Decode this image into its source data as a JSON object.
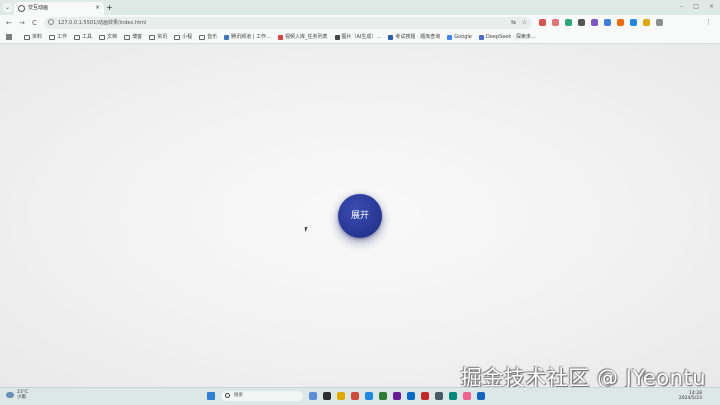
{
  "tab": {
    "title": "交互动画",
    "close": "×",
    "new_tab": "+"
  },
  "window_controls": [
    "–",
    "□",
    "×"
  ],
  "nav": {
    "back": "←",
    "forward": "→",
    "reload": "C"
  },
  "omnibox": {
    "url": "127.0.0.1:5501/动画效果/index.html"
  },
  "bookmarks": [
    {
      "label": "资料",
      "type": "folder"
    },
    {
      "label": "工作",
      "type": "folder"
    },
    {
      "label": "工具",
      "type": "folder"
    },
    {
      "label": "文档",
      "type": "folder"
    },
    {
      "label": "博客",
      "type": "folder"
    },
    {
      "label": "资讯",
      "type": "folder"
    },
    {
      "label": "小程",
      "type": "folder"
    },
    {
      "label": "音乐",
      "type": "folder"
    },
    {
      "label": "腾讯频道 | 工作…",
      "type": "link",
      "color": "#3a77c4"
    },
    {
      "label": "视频入库_任务列表",
      "type": "link",
      "color": "#d44"
    },
    {
      "label": "图片（AI生成）…",
      "type": "link",
      "color": "#444"
    },
    {
      "label": "考试搜题 · 题库查询",
      "type": "link",
      "color": "#2a5fb3"
    },
    {
      "label": "Google",
      "type": "link",
      "color": "#4285f4"
    },
    {
      "label": "DeepSeek · 探索未…",
      "type": "link",
      "color": "#4b6bd6"
    }
  ],
  "extensions": [
    "#d9534f",
    "#e57373",
    "#2aa876",
    "#555555",
    "#7e57c2",
    "#3f7fd9",
    "#ef6c00",
    "#1e88e5",
    "#e0a800",
    "#8e8e8e"
  ],
  "page": {
    "expand_label": "展开"
  },
  "watermark": "掘金技术社区 @ JYeontu",
  "taskbar": {
    "weather_temp": "23°C",
    "weather_desc": "小雨",
    "search_placeholder": "搜索",
    "apps": [
      "#5b8fd6",
      "#2c2c2c",
      "#e2a800",
      "#d04a3a",
      "#1e88e5",
      "#2e7d32",
      "#6a1b9a",
      "#0b6bcb",
      "#c62828",
      "#455a64",
      "#00897b",
      "#f06292",
      "#1565c0"
    ],
    "time": "14:28",
    "date": "2024/5/23"
  }
}
